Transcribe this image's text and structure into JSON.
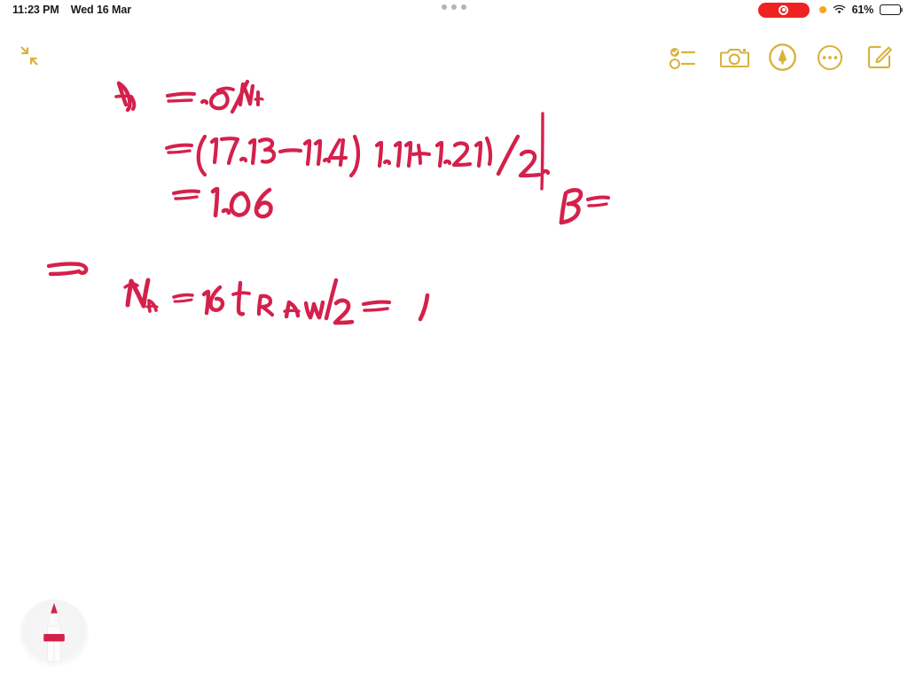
{
  "status_bar": {
    "time": "11:23 PM",
    "date": "Wed 16 Mar",
    "battery_percent_label": "61%",
    "battery_level": 61,
    "recording_indicator": "screen-recording-active",
    "privacy_indicator": "microphone-in-use",
    "wifi_icon": "wifi-icon",
    "multitask_handle": "multitasking-handle"
  },
  "toolbar": {
    "collapse_label": "collapse-note",
    "checklist_label": "checklist",
    "camera_label": "insert-media",
    "markup_label": "markup",
    "more_label": "more-options",
    "compose_label": "new-note",
    "accent_color": "#d8b33e"
  },
  "note": {
    "ink_color": "#d4214c",
    "background_color": "#ffffff",
    "lines": [
      {
        "id": "l1",
        "text": "A   =  ·σ /Nᵢ"
      },
      {
        "id": "l2",
        "text": "= (17·13−11·4)  1·11 + 1·21) /2·"
      },
      {
        "id": "l3",
        "text": "=  1· 06"
      },
      {
        "id": "l4",
        "text": "⇒"
      },
      {
        "id": "l5",
        "text": "Nₐ  =  16 tᵣ ᴀ ᴡ /2     =    1"
      },
      {
        "id": "l6",
        "text": "B ="
      }
    ],
    "divider": "vertical-rule"
  },
  "pen_tool": {
    "label": "pen-tool",
    "ink_color": "#d4214c",
    "state": "selected"
  }
}
